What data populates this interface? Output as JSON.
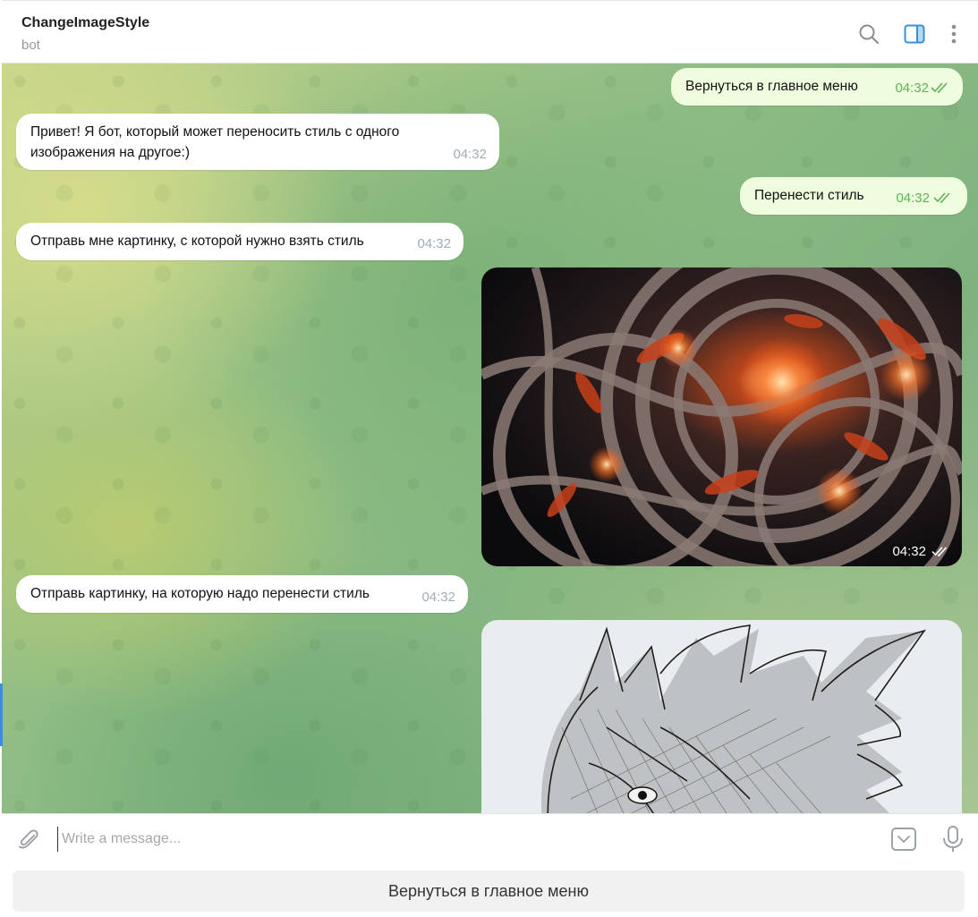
{
  "header": {
    "title": "ChangeImageStyle",
    "status": "bot"
  },
  "messages": [
    {
      "direction": "out",
      "text": "Вернуться в главное меню",
      "time": "04:32",
      "read": true
    },
    {
      "direction": "in",
      "text": "Привет! Я бот, который может переносить стиль с одного изображения на другое:)",
      "time": "04:32"
    },
    {
      "direction": "out",
      "text": "Перенести стиль",
      "time": "04:32",
      "read": true
    },
    {
      "direction": "in",
      "text": "Отправь мне картинку, с которой нужно взять стиль",
      "time": "04:32"
    },
    {
      "direction": "out",
      "type": "photo",
      "time": "04:32",
      "read": true
    },
    {
      "direction": "in",
      "text": "Отправь картинку, на которую надо перенести стиль",
      "time": "04:32"
    },
    {
      "direction": "out",
      "type": "photo"
    }
  ],
  "composer": {
    "placeholder": "Write a message..."
  },
  "reply_keyboard": {
    "button": "Вернуться в главное меню"
  },
  "colors": {
    "outgoing_bubble": "#effdde",
    "incoming_bubble": "#ffffff",
    "read_check": "#5fb35a",
    "accent": "#3a8fd6"
  },
  "icons": [
    "search-icon",
    "sidebar-toggle-icon",
    "more-vertical-icon",
    "paperclip-icon",
    "bot-keyboard-icon",
    "microphone-icon",
    "chevron-down-icon"
  ]
}
